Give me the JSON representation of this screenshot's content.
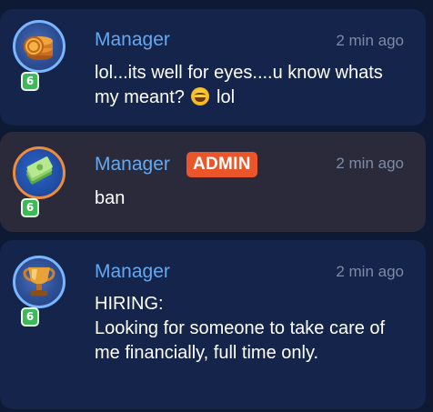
{
  "messages": [
    {
      "username": "Manager",
      "timestamp": "2 min ago",
      "level": "6",
      "avatar_icon": "coin-stack-icon",
      "text_before_emoji": "lol...its well for eyes....u know whats my meant? ",
      "emoji": "laughing-emoji-icon",
      "text_after_emoji": " lol"
    },
    {
      "username": "Manager",
      "badge": "ADMIN",
      "timestamp": "2 min ago",
      "level": "6",
      "avatar_icon": "money-stack-icon",
      "text": "ban"
    },
    {
      "username": "Manager",
      "timestamp": "2 min ago",
      "level": "6",
      "avatar_icon": "trophy-cup-icon",
      "text": "HIRING:\nLooking for someone to take care of me financially, full time only."
    }
  ],
  "colors": {
    "background": "#0e1a33",
    "card": "#14244a",
    "card_admin": "#2a2a3b",
    "username": "#65a8ef",
    "admin_badge": "#eb552a",
    "timestamp": "#7e8aa6",
    "level_badge": "#3fb85a"
  }
}
